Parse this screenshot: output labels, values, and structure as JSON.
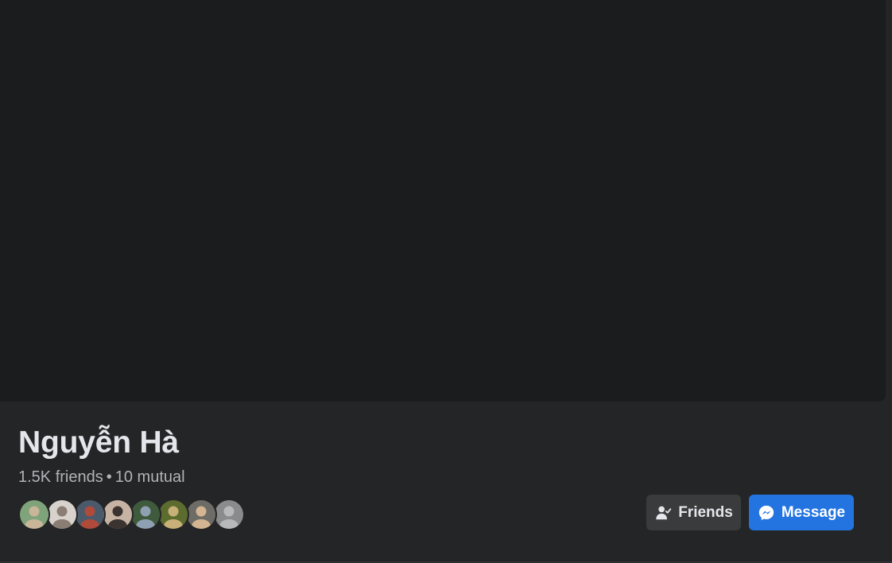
{
  "profile": {
    "name": "Nguyễn Hà",
    "friends_count": "1.5K friends",
    "separator": "•",
    "mutual_count": "10 mutual"
  },
  "mutual_avatars": [
    {
      "name": "mutual-friend-1",
      "colors": [
        "#7fa37a",
        "#c9b59a"
      ]
    },
    {
      "name": "mutual-friend-2",
      "colors": [
        "#d8d2cc",
        "#8a7d74"
      ]
    },
    {
      "name": "mutual-friend-3",
      "colors": [
        "#4a5a6a",
        "#b04a3a"
      ]
    },
    {
      "name": "mutual-friend-4",
      "colors": [
        "#c7b3a4",
        "#3b3330"
      ]
    },
    {
      "name": "mutual-friend-5",
      "colors": [
        "#3f5a3c",
        "#8fa0b2"
      ]
    },
    {
      "name": "mutual-friend-6",
      "colors": [
        "#5c6b2e",
        "#c8b078"
      ]
    },
    {
      "name": "mutual-friend-7",
      "colors": [
        "#6e6c66",
        "#d4b592"
      ]
    },
    {
      "name": "mutual-friend-8-default",
      "colors": [
        "#8a8b8d",
        "#b8b9bb"
      ]
    }
  ],
  "actions": {
    "friends_label": "Friends",
    "friends_icon": "friends-check-icon",
    "message_label": "Message",
    "message_icon": "messenger-icon"
  },
  "colors": {
    "background": "#242526",
    "cover": "#1b1c1e",
    "primary_text": "#e4e6eb",
    "secondary_text": "#b0b3b8",
    "accent": "#2374e1",
    "secondary_button": "#3a3b3c"
  }
}
